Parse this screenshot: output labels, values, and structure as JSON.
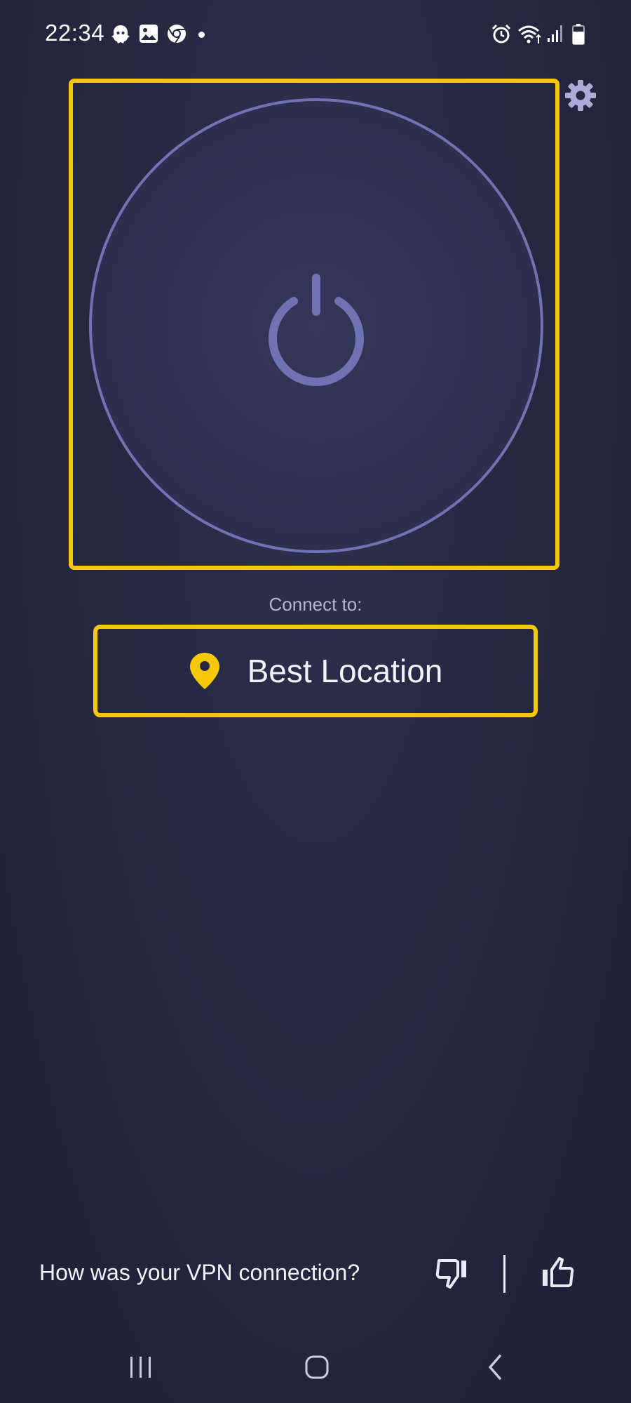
{
  "status_bar": {
    "time": "22:34",
    "left_icons": [
      "snapchat-ghost-icon",
      "gallery-icon",
      "chrome-icon",
      "notification-dot"
    ],
    "right_icons": [
      "alarm-icon",
      "wifi-icon",
      "signal-icon",
      "battery-icon"
    ]
  },
  "settings": {
    "icon": "gear-icon"
  },
  "power": {
    "icon": "power-icon"
  },
  "connect": {
    "label": "Connect to:",
    "location": "Best Location",
    "icon": "location-pin-icon"
  },
  "feedback": {
    "question": "How was your VPN connection?",
    "dislike_icon": "thumbs-down-icon",
    "like_icon": "thumbs-up-icon"
  },
  "nav": {
    "icons": [
      "recent-apps-icon",
      "home-icon",
      "back-icon"
    ]
  },
  "colors": {
    "accent": "#f7c80a",
    "ring": "#6f73b3",
    "background": "#262841",
    "text": "#f1f2fa",
    "muted_text": "#b3b5cf"
  }
}
